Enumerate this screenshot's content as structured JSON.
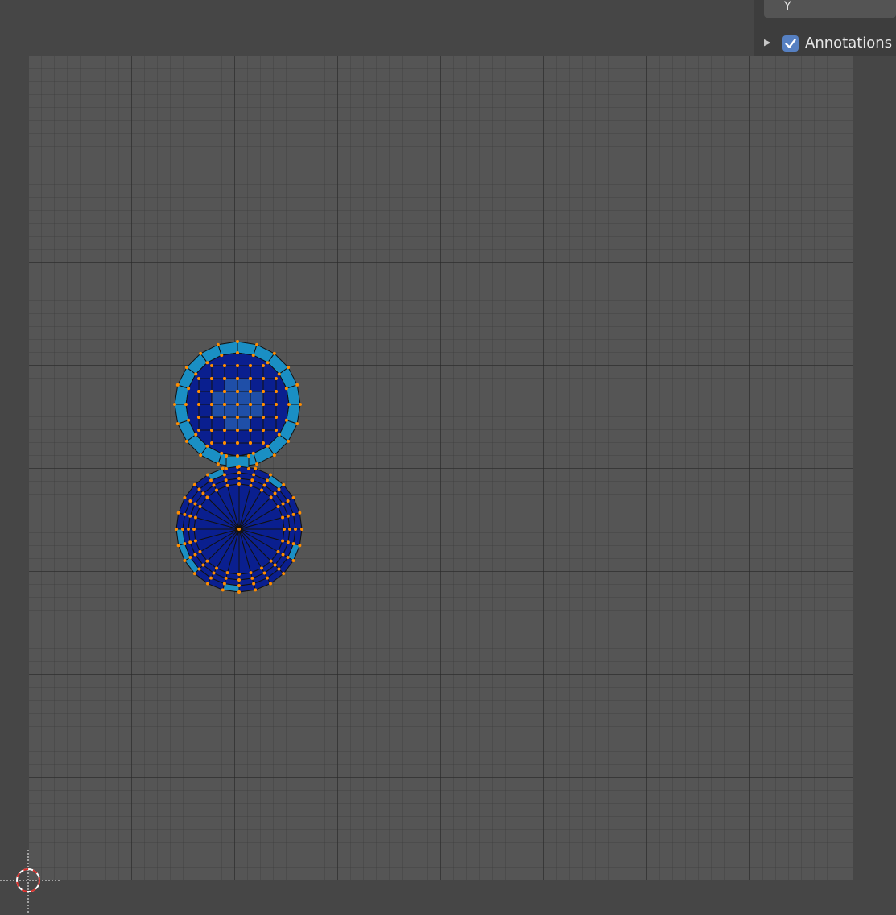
{
  "sidebar": {
    "axis_label": "Y",
    "annotations_label": "Annotations",
    "annotations_checked": true,
    "checkbox_color": "#5680c2"
  },
  "uv_editor": {
    "background_color": "#555555",
    "face_color": "#0a1f8f",
    "stretch_color": "#1a8fc4",
    "edge_color": "#111111",
    "vertex_color": "#ff8c00",
    "islands": [
      "sphere-uv-island",
      "circle-fan-uv-island"
    ]
  },
  "icons": {
    "expand": "disclosure-triangle-icon",
    "check": "checkmark-icon",
    "cursor": "2d-cursor-icon"
  }
}
